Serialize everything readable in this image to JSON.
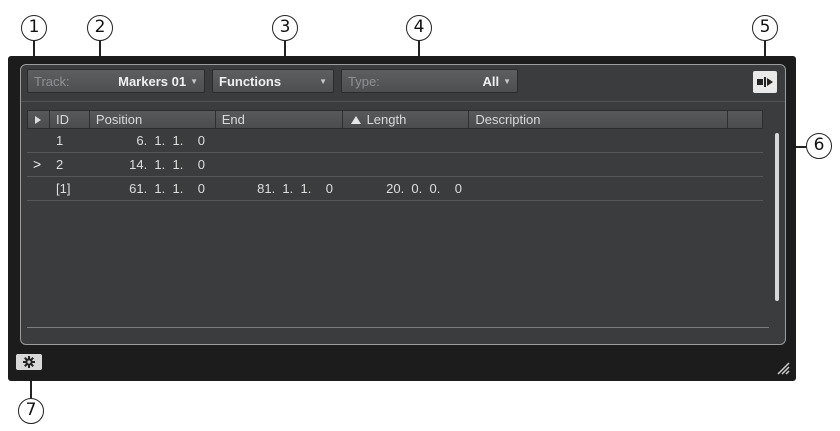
{
  "toolbar": {
    "track_label": "Track:",
    "track_value": "Markers 01",
    "functions_label": "Functions",
    "type_label": "Type:",
    "type_value": "All"
  },
  "table": {
    "columns": [
      "ID",
      "Position",
      "End",
      "Length",
      "Description"
    ],
    "rows": [
      {
        "selected": "",
        "id": "1",
        "position": "6.  1.  1.    0",
        "end": "",
        "length": "",
        "description": ""
      },
      {
        "selected": ">",
        "id": "2",
        "position": "14.  1.  1.    0",
        "end": "",
        "length": "",
        "description": ""
      },
      {
        "selected": "",
        "id": "[1]",
        "position": "61.  1.  1.    0",
        "end": "81.  1.  1.    0",
        "length": "20.  0.  0.    0",
        "description": ""
      }
    ]
  },
  "callouts": [
    "1",
    "2",
    "3",
    "4",
    "5",
    "6",
    "7"
  ],
  "icons": {
    "expand": "show-inspector-icon",
    "settings": "gear-icon",
    "resize": "resize-grip-icon",
    "sort": "sort-ascending-icon",
    "caret": "dropdown-caret-icon"
  },
  "colors": {
    "frame": "#1c1c1c",
    "panel": "#3a3c3e",
    "text": "#dedede"
  }
}
